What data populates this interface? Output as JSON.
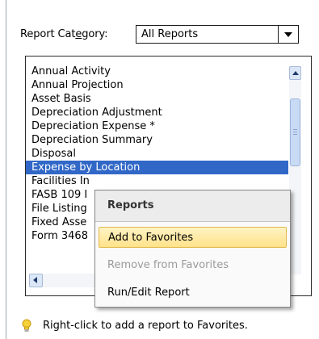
{
  "category": {
    "label_prefix": "Report Cat",
    "label_accel": "e",
    "label_suffix": "gory:",
    "selected": "All Reports"
  },
  "reports": {
    "items": [
      "Annual Activity",
      "Annual Projection",
      "Asset Basis",
      "Depreciation Adjustment",
      "Depreciation Expense *",
      "Depreciation Summary",
      "Disposal",
      "Expense by Location",
      "Facilities In",
      "FASB 109 I",
      "File Listing",
      "Fixed Asse",
      "Form 3468"
    ],
    "selected_index": 7
  },
  "context_menu": {
    "header": "Reports",
    "items": [
      {
        "label": "Add to Favorites",
        "state": "hover"
      },
      {
        "label": "Remove from Favorites",
        "state": "disabled"
      },
      {
        "label": "Run/Edit Report",
        "state": "normal"
      }
    ]
  },
  "hint": {
    "icon": "lightbulb-icon",
    "text": "Right-click to add a report to Favorites."
  },
  "colors": {
    "selection": "#3168c7",
    "menu_hover": "#ffe28a",
    "hint_icon": "#f0c419"
  }
}
